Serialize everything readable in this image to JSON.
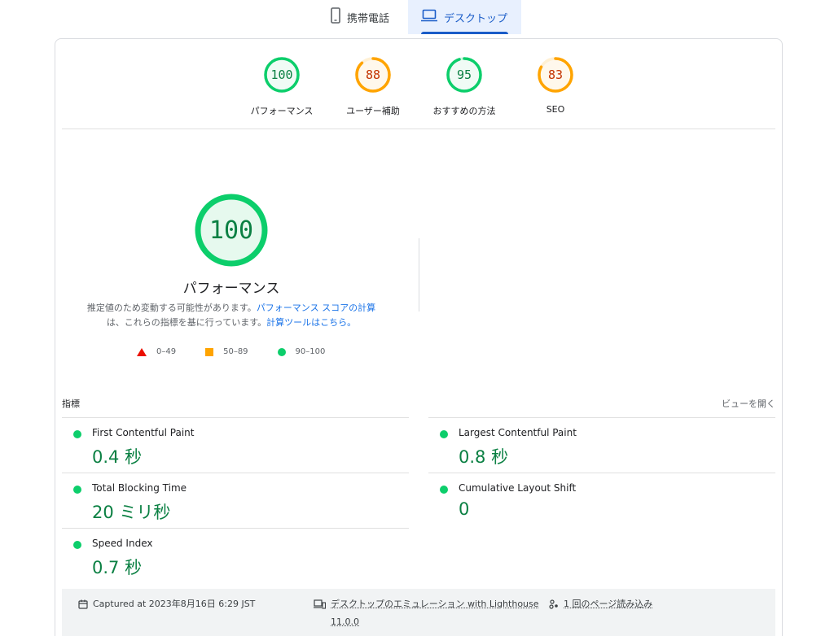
{
  "tabs": {
    "mobile_label": "携帯電話",
    "desktop_label": "デスクトップ"
  },
  "summary": [
    {
      "score": "100",
      "label": "パフォーマンス",
      "value": 100,
      "color": "#0cce6b",
      "text_color": "#0b8043"
    },
    {
      "score": "88",
      "label": "ユーザー補助",
      "value": 88,
      "color": "#ffa400",
      "text_color": "#c33300"
    },
    {
      "score": "95",
      "label": "おすすめの方法",
      "value": 95,
      "color": "#0cce6b",
      "text_color": "#0b8043"
    },
    {
      "score": "83",
      "label": "SEO",
      "value": 83,
      "color": "#ffa400",
      "text_color": "#c33300"
    }
  ],
  "performance": {
    "score": "100",
    "title": "パフォーマンス",
    "desc_1": "推定値のため変動する可能性があります。",
    "link_1": "パフォーマンス スコアの計算",
    "desc_2": "は、これらの指標を基に行っています。",
    "link_2": "計算ツールはこちら。"
  },
  "legend": {
    "fail": "0–49",
    "average": "50–89",
    "pass": "90–100"
  },
  "metrics": {
    "header": "指標",
    "expand_label": "ビューを開く",
    "items": [
      {
        "name": "First Contentful Paint",
        "value": "0.4 秒"
      },
      {
        "name": "Largest Contentful Paint",
        "value": "0.8 秒"
      },
      {
        "name": "Total Blocking Time",
        "value": "20 ミリ秒"
      },
      {
        "name": "Cumulative Layout Shift",
        "value": "0"
      },
      {
        "name": "Speed Index",
        "value": "0.7 秒"
      }
    ]
  },
  "runinfo": {
    "captured": "Captured at 2023年8月16日 6:29 JST",
    "emulation": "デスクトップのエミュレーション with Lighthouse",
    "version": "11.0.0",
    "page_load": "1 回のページ読み込み"
  },
  "icons": {
    "mobile": "phone-icon",
    "desktop": "laptop-icon",
    "calendar": "calendar-icon",
    "devices": "devices-icon",
    "load": "page-load-icon"
  }
}
